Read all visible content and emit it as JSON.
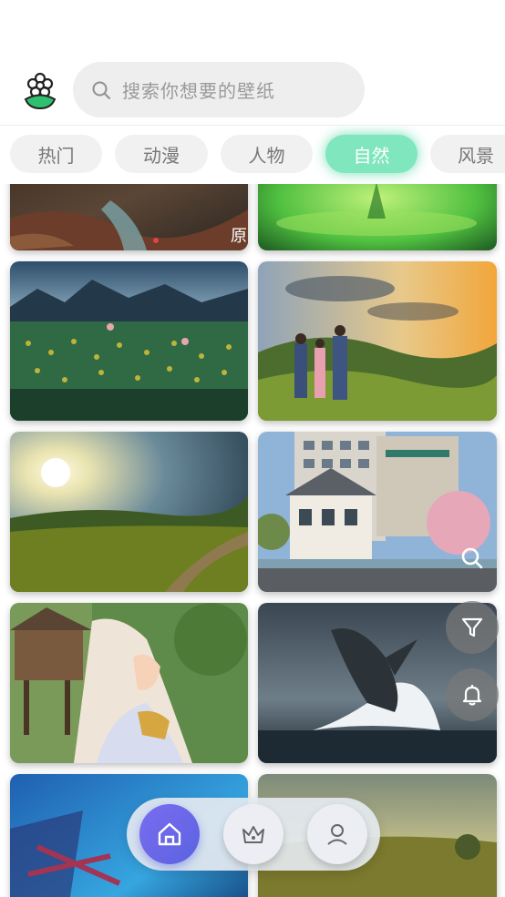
{
  "search": {
    "placeholder": "搜索你想要的壁纸"
  },
  "tabs": [
    {
      "label": "热门",
      "active": false
    },
    {
      "label": "动漫",
      "active": false
    },
    {
      "label": "人物",
      "active": false
    },
    {
      "label": "自然",
      "active": true
    },
    {
      "label": "风景",
      "active": false
    }
  ],
  "wallpapers": [
    {
      "subject": "anime river scene",
      "caption": "原"
    },
    {
      "subject": "green fantasy glow"
    },
    {
      "subject": "anime flower field with misty mountains"
    },
    {
      "subject": "family looking at sunset hills"
    },
    {
      "subject": "sunlit vineyard road"
    },
    {
      "subject": "european houses street"
    },
    {
      "subject": "anime girl with treehouse"
    },
    {
      "subject": "whale breaching ocean"
    },
    {
      "subject": "blue fantasy forest"
    },
    {
      "subject": "golden field landscape"
    }
  ],
  "floating_buttons": [
    "search-icon",
    "filter-icon",
    "bell-icon"
  ],
  "bottom_nav": [
    "home-icon",
    "crown-icon",
    "user-icon"
  ],
  "colors": {
    "accent_tab": "#7fe6be",
    "nav_active": "#6a68e8",
    "search_bg": "#eeeeee"
  }
}
